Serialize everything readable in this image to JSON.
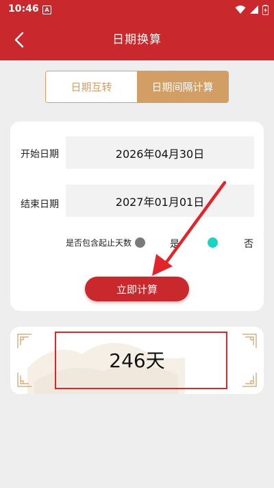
{
  "status_bar": {
    "time": "10:46",
    "app_badge": "A",
    "icons": [
      "wifi-icon",
      "signal-icon",
      "battery-icon"
    ]
  },
  "header": {
    "title": "日期换算",
    "back_icon": "chevron-left-icon"
  },
  "tabs": [
    {
      "label": "日期互转",
      "active": false
    },
    {
      "label": "日期间隔计算",
      "active": true
    }
  ],
  "form": {
    "start_label": "开始日期",
    "start_value": "2026年04月30日",
    "end_label": "结束日期",
    "end_value": "2027年01月01日",
    "include_label": "是否包含起止天数",
    "options": [
      {
        "label": "是",
        "selected": false,
        "color": "#7a7a7a"
      },
      {
        "label": "否",
        "selected": true,
        "color": "#19d3c3"
      }
    ],
    "calc_button": "立即计算"
  },
  "result": {
    "value": "246天"
  },
  "colors": {
    "primary": "#c9282d",
    "gold": "#d29e63",
    "accent": "#19d3c3"
  }
}
